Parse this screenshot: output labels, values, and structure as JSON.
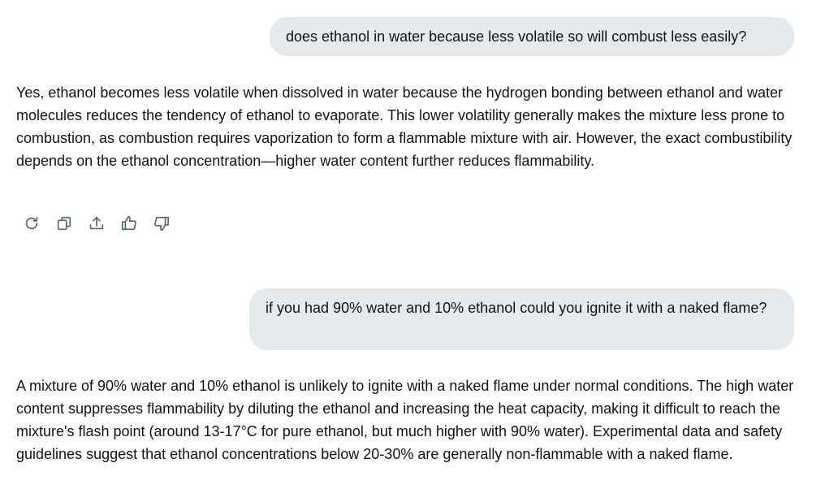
{
  "conversation": {
    "messages": [
      {
        "role": "user",
        "text": "does ethanol in water because less volatile so will combust less easily?"
      },
      {
        "role": "assistant",
        "text": "Yes, ethanol becomes less volatile when dissolved in water because the hydrogen bonding between ethanol and water molecules reduces the tendency of ethanol to evaporate. This lower volatility generally makes the mixture less prone to combustion, as combustion requires vaporization to form a flammable mixture with air. However, the exact combustibility depends on the ethanol concentration—higher water content further reduces flammability."
      },
      {
        "role": "user",
        "text": "if you had 90% water and 10% ethanol could you ignite it with a naked flame?"
      },
      {
        "role": "assistant",
        "text": "A mixture of 90% water and 10% ethanol is unlikely to ignite with a naked flame under normal conditions. The high water content suppresses flammability by diluting the ethanol and increasing the heat capacity, making it difficult to reach the mixture's flash point (around 13-17°C for pure ethanol, but much higher with 90% water). Experimental data and safety guidelines suggest that ethanol concentrations below 20-30% are generally non-flammable with a naked flame."
      }
    ]
  },
  "actions": {
    "icons": [
      "regenerate-icon",
      "copy-icon",
      "share-icon",
      "thumbs-up-icon",
      "thumbs-down-icon"
    ],
    "icon_color": "#536471"
  },
  "colors": {
    "user_bubble_bg": "#e6eaed",
    "text": "#0f1419"
  }
}
